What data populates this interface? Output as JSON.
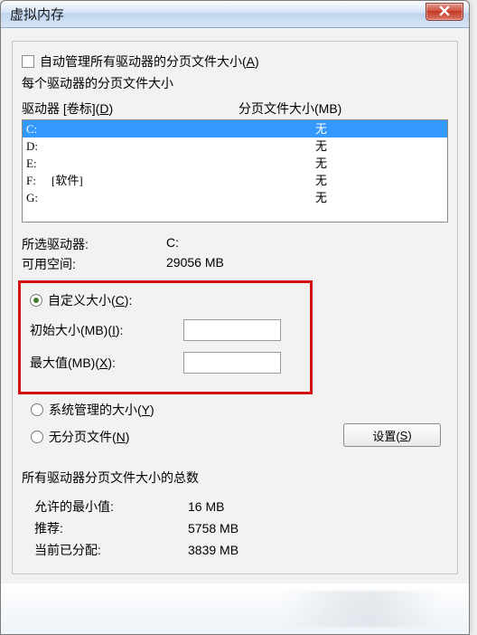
{
  "window": {
    "title": "虚拟内存"
  },
  "autoManage": {
    "label": "自动管理所有驱动器的分页文件大小(",
    "hotkey": "A",
    "label_end": ")"
  },
  "perDriveLabel": "每个驱动器的分页文件大小",
  "driveHeader": {
    "left_a": "驱动器 [卷标](",
    "left_hk": "D",
    "left_b": ")",
    "right": "分页文件大小(MB)"
  },
  "drives": [
    {
      "letter": "C:",
      "label": "",
      "size": "无"
    },
    {
      "letter": "D:",
      "label": "",
      "size": "无"
    },
    {
      "letter": "E:",
      "label": "",
      "size": "无"
    },
    {
      "letter": "F:",
      "label": "[软件]",
      "size": "无"
    },
    {
      "letter": "G:",
      "label": "",
      "size": "无"
    }
  ],
  "selectedDrive": {
    "label": "所选驱动器:",
    "value": "C:"
  },
  "freeSpace": {
    "label": "可用空间:",
    "value": "29056 MB"
  },
  "customSize": {
    "label_a": "自定义大小(",
    "hk": "C",
    "label_b": "):"
  },
  "initialSize": {
    "label_a": "初始大小(MB)(",
    "hk": "I",
    "label_b": "):",
    "value": ""
  },
  "maxSize": {
    "label_a": "最大值(MB)(",
    "hk": "X",
    "label_b": "):",
    "value": ""
  },
  "systemManaged": {
    "label_a": "系统管理的大小(",
    "hk": "Y",
    "label_b": ")"
  },
  "noPageFile": {
    "label_a": "无分页文件(",
    "hk": "N",
    "label_b": ")"
  },
  "setButton": {
    "label_a": "设置(",
    "hk": "S",
    "label_b": ")"
  },
  "totals": {
    "title": "所有驱动器分页文件大小的总数",
    "min": {
      "label": "允许的最小值:",
      "value": "16 MB"
    },
    "rec": {
      "label": "推荐:",
      "value": "5758 MB"
    },
    "cur": {
      "label": "当前已分配:",
      "value": "3839 MB"
    }
  }
}
